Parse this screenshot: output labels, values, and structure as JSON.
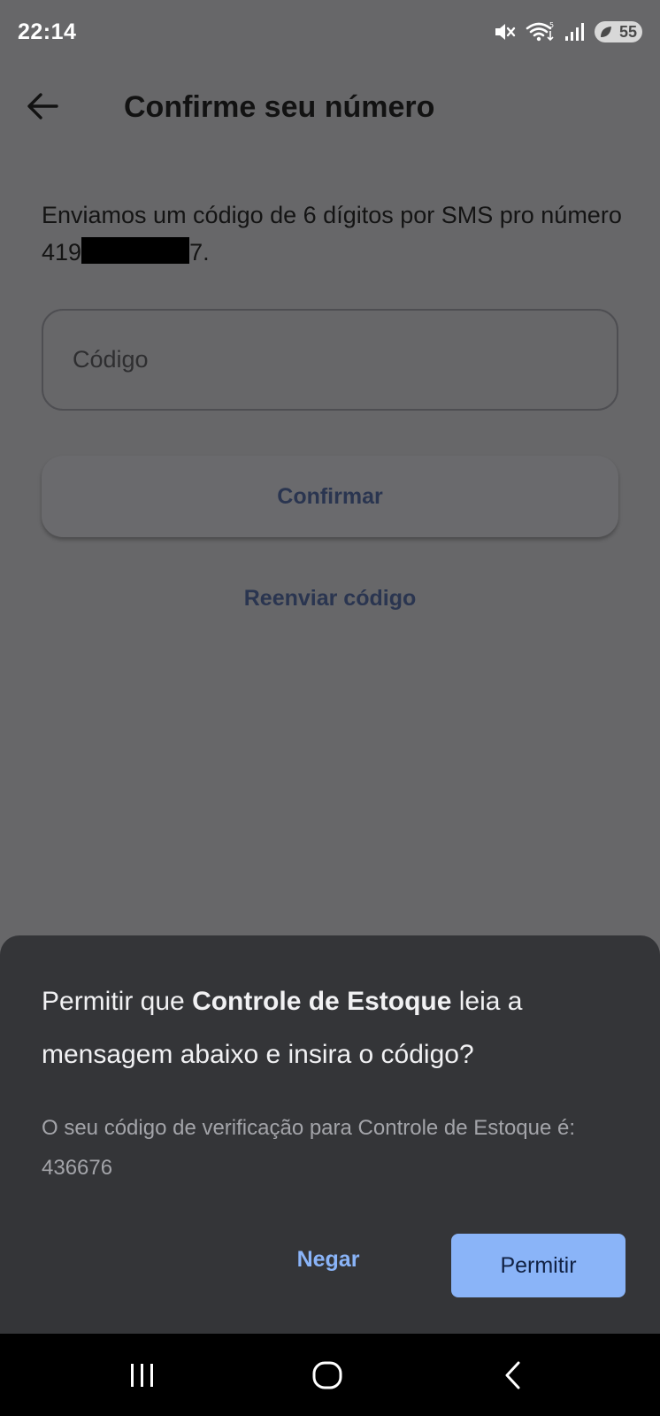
{
  "status_bar": {
    "time": "22:14",
    "battery": "55",
    "icons": [
      "mute-icon",
      "wifi-icon",
      "signal-icon",
      "battery-icon"
    ]
  },
  "app_bar": {
    "back_icon": "arrow-left-icon",
    "title": "Confirme seu número"
  },
  "main": {
    "description_prefix": "Enviamos um código de 6 dígitos por SMS pro número 419",
    "description_suffix": "7.",
    "code_placeholder": "Código",
    "confirm_label": "Confirmar",
    "resend_label": "Reenviar código"
  },
  "dialog": {
    "title_prefix": "Permitir que ",
    "app_name": "Controle de Estoque",
    "title_suffix": " leia a mensagem abaixo e insira o código?",
    "message": "O seu código de verificação para Controle de Estoque é: 436676",
    "deny_label": "Negar",
    "allow_label": "Permitir",
    "accent_color": "#8ab4f8"
  },
  "nav_bar": {
    "icons": [
      "recents-icon",
      "home-icon",
      "back-icon"
    ]
  }
}
